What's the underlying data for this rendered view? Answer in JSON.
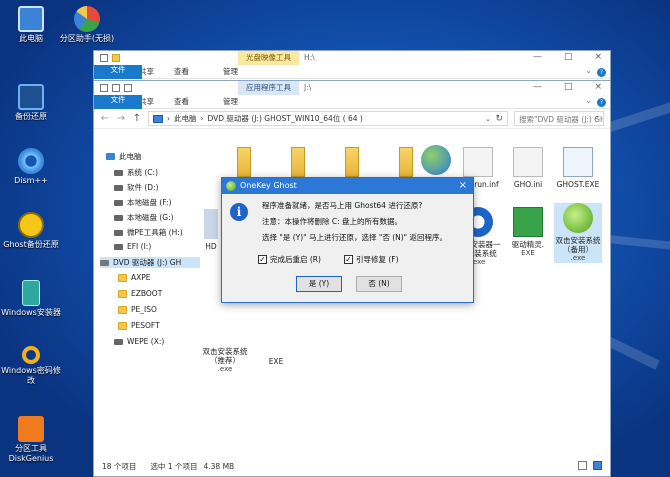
{
  "desktop": {
    "icons": [
      {
        "label": "此电脑"
      },
      {
        "label": "分区助手(无损)"
      },
      {
        "label": "备份还原"
      },
      {
        "label": "Dism++"
      },
      {
        "label": "Ghost备份还原"
      },
      {
        "label": "Windows安装器"
      },
      {
        "label": "Windows密码修改"
      },
      {
        "label": "分区工具DiskGenius"
      }
    ]
  },
  "back_window": {
    "context_tab": "光盘映像工具",
    "path": "H:\\",
    "ribbon_tabs": [
      "文件",
      "主页",
      "共享",
      "查看"
    ],
    "context_sub": "管理",
    "controls": [
      "—",
      "□",
      "×"
    ]
  },
  "front_window": {
    "context_tab": "应用程序工具",
    "path": "J:\\",
    "ribbon_tabs": [
      "文件",
      "主页",
      "共享",
      "查看"
    ],
    "context_sub": "管理",
    "controls": [
      "—",
      "□",
      "×"
    ],
    "nav": {
      "back": "←",
      "forward": "→",
      "up": "↑"
    },
    "address_crumbs": [
      "此电脑",
      "DVD 驱动器 (J:) GHOST_WIN10_64位 ( 64 )"
    ],
    "search_placeholder": "搜索\"DVD 驱动器 (J:) GHOS...",
    "tree": [
      "此电脑",
      "系统 (C:)",
      "软件 (D:)",
      "本地磁盘 (F:)",
      "本地磁盘 (G:)",
      "微PE工具箱 (H:)",
      "EFI (I:)",
      "DVD 驱动器 (J:) GH",
      "AXPE",
      "EZBOOT",
      "PE_ISO",
      "PESOFT",
      "WEPE (X:)"
    ],
    "files": {
      "folder1": "",
      "folder2": "",
      "folder3": "",
      "folder4": "",
      "network": "",
      "autorun": "autorun.inf",
      "gho_ini": "GHO.ini",
      "ghost_exe": "GHOST.EXE",
      "partial_hd": "HD",
      "installer_name": "硬盘安装器一键安装系统",
      "installer_ext": ".exe",
      "driver_name": "驱动精灵.",
      "driver_ext": "EXE",
      "dual_name": "双击安装系统（备用）",
      "dual_ext": ".exe",
      "bottom1_name": "双击安装系统（推荐）",
      "bottom1_ext": ".exe",
      "bottom2_name": "EXE"
    },
    "status": {
      "count": "18 个项目",
      "selected": "选中 1 个项目",
      "size": "4.38 MB"
    }
  },
  "dialog": {
    "title": "OneKey Ghost",
    "close": "×",
    "line1": "程序准备就绪，是否马上用 Ghost64 进行还原?",
    "line2": "注意：本操作将删除 C: 盘上的所有数据。",
    "line3": "选择 \"是 (Y)\" 马上进行还原，选择 \"否 (N)\" 返回程序。",
    "checkbox_reboot": "完成后重启 (R)",
    "checkbox_boot": "引导修复 (F)",
    "btn_yes": "是 (Y)",
    "btn_no": "否 (N)"
  },
  "colors": {
    "accent": "#1979ca",
    "dialog_title": "#2b78d6",
    "desktop": "#1355b5"
  }
}
